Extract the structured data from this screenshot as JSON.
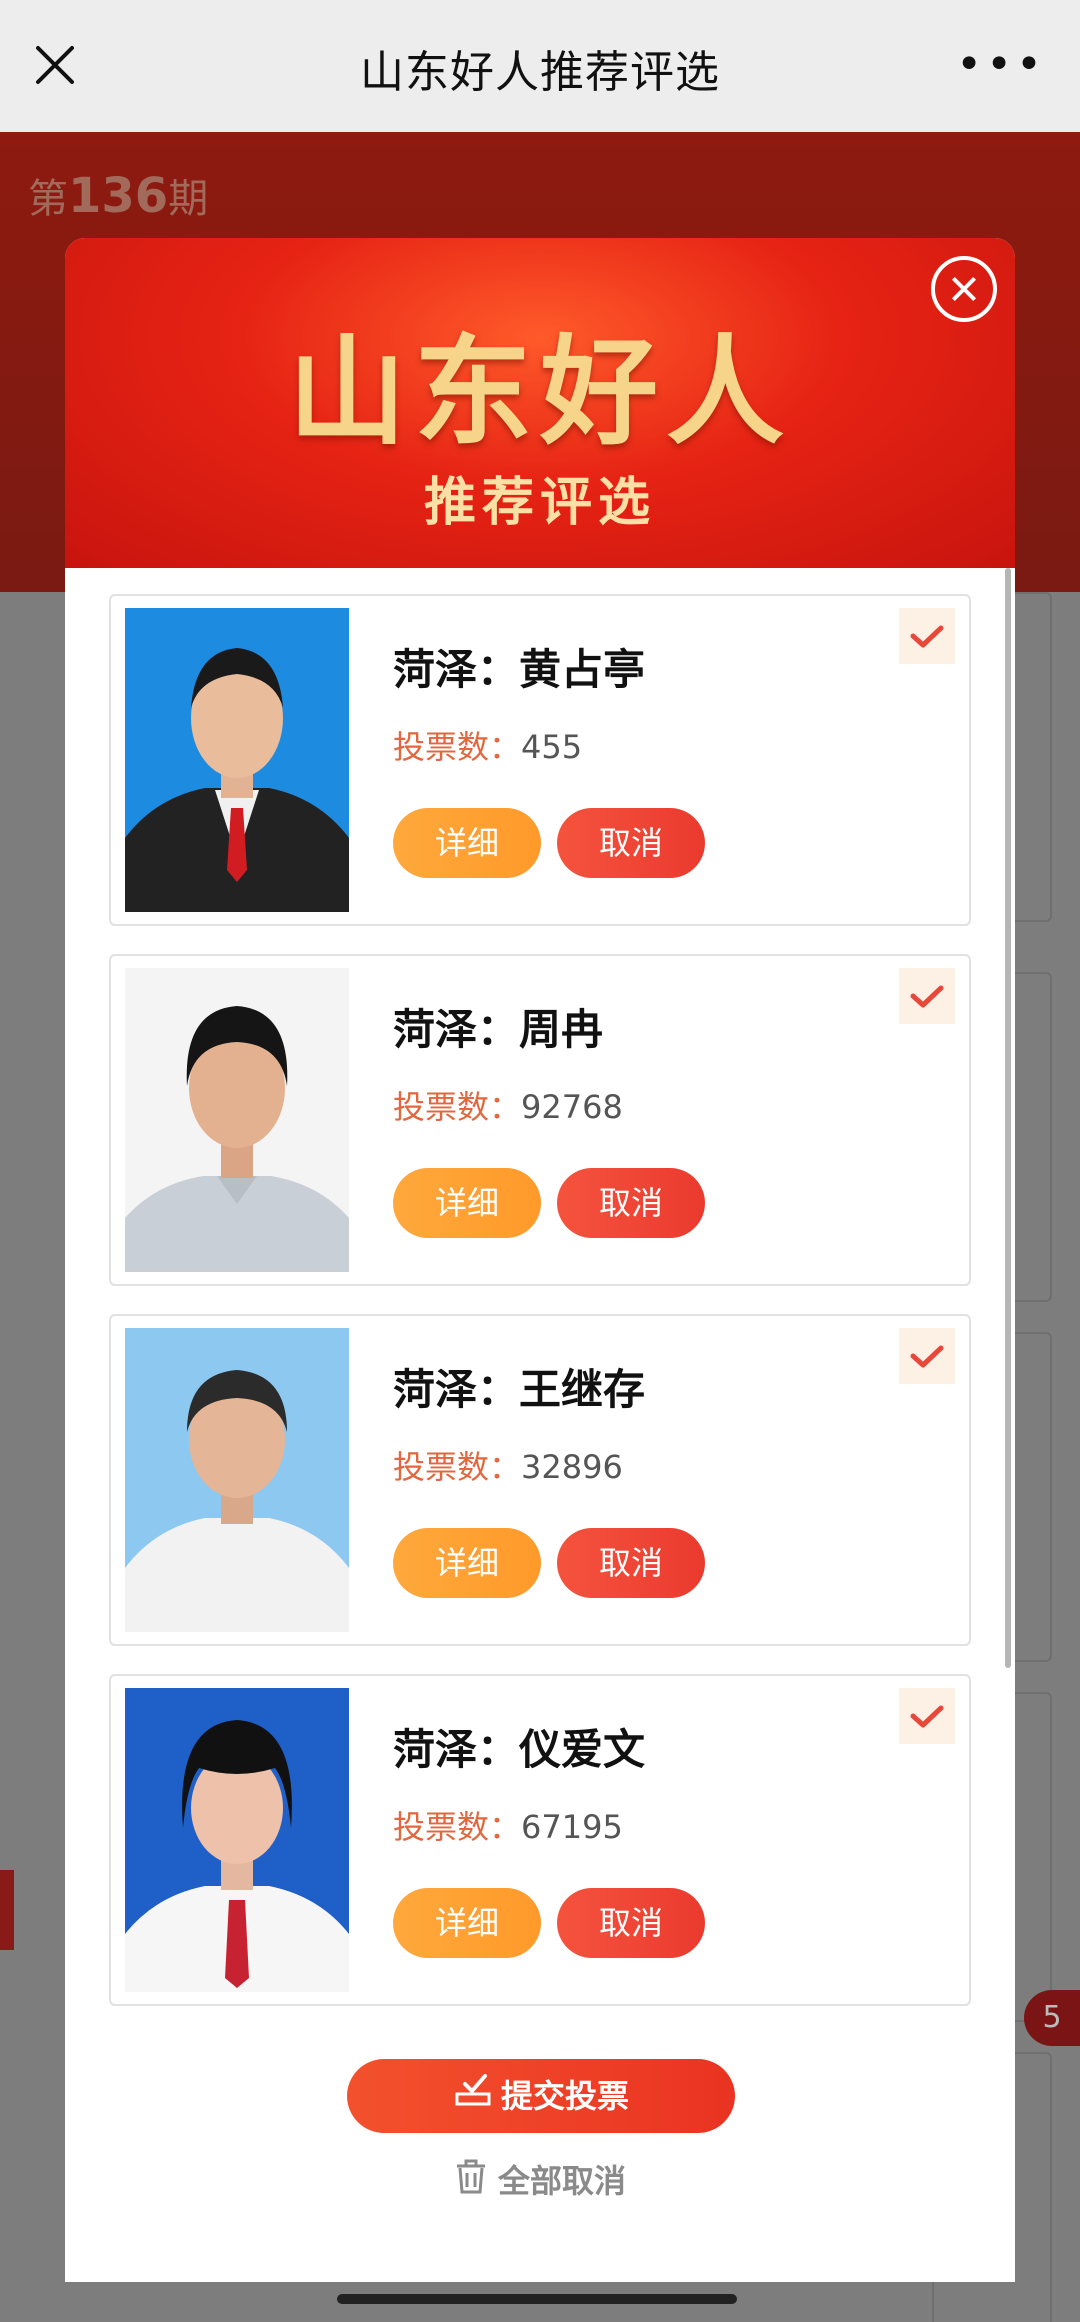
{
  "topbar": {
    "title": "山东好人推荐评选",
    "more": "•••"
  },
  "background": {
    "period_prefix": "第",
    "period_number": "136",
    "period_suffix": "期",
    "badge": "5"
  },
  "modal": {
    "logo_main": "山东好人",
    "logo_sub": "推荐评选",
    "candidates": [
      {
        "name": "菏泽：黄占亭",
        "vote_label": "投票数：",
        "votes": "455",
        "detail_label": "详细",
        "cancel_label": "取消",
        "selected": true
      },
      {
        "name": "菏泽：周冉",
        "vote_label": "投票数：",
        "votes": "92768",
        "detail_label": "详细",
        "cancel_label": "取消",
        "selected": true
      },
      {
        "name": "菏泽：王继存",
        "vote_label": "投票数：",
        "votes": "32896",
        "detail_label": "详细",
        "cancel_label": "取消",
        "selected": true
      },
      {
        "name": "菏泽：仪爱文",
        "vote_label": "投票数：",
        "votes": "67195",
        "detail_label": "详细",
        "cancel_label": "取消",
        "selected": true
      }
    ],
    "submit_label": "提交投票",
    "cancel_all_label": "全部取消"
  },
  "colors": {
    "accent_red": "#ea3a2e",
    "accent_orange": "#ffa83c",
    "check_red": "#e8483a"
  }
}
